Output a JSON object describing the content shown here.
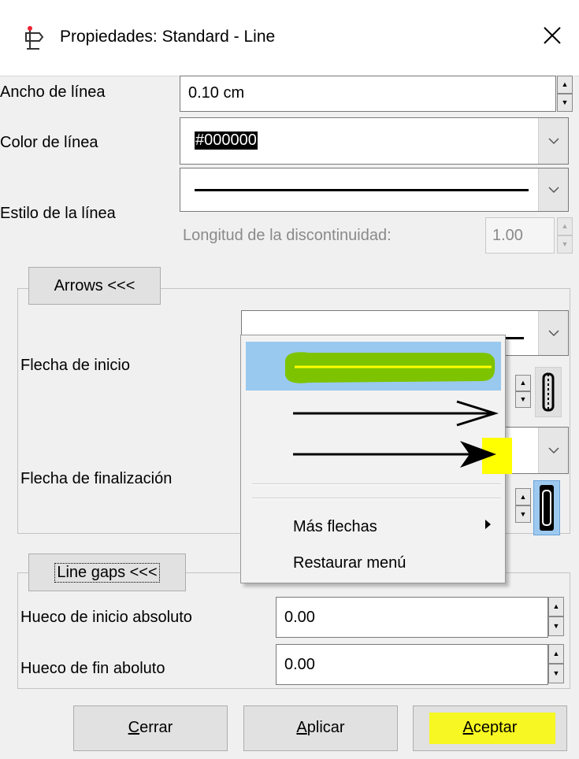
{
  "window": {
    "title": "Propiedades: Standard - Line",
    "close_icon": "close-icon",
    "app_icon": "properties-icon"
  },
  "line": {
    "width_label": "Ancho de línea",
    "width_value": "0.10 cm",
    "color_label": "Color de línea",
    "color_value": "#000000",
    "style_label": "Estilo de la línea",
    "dash_label": "Longitud de la discontinuidad:",
    "dash_value": "1.00"
  },
  "arrows": {
    "toggle_label": "Arrows <<<",
    "start_label": "Flecha de inicio",
    "end_label": "Flecha de finalización"
  },
  "menu": {
    "items": [
      "line-no-arrow",
      "line-open-arrow",
      "line-filled-arrow"
    ],
    "more_label": "Más flechas",
    "restore_label": "Restaurar menú",
    "highlight_color": "#99c9ef",
    "marker_green": "#7ec300",
    "marker_yellow": "#ffff00"
  },
  "gaps": {
    "toggle_label": "Line gaps <<<",
    "start_label": "Hueco de inicio absoluto",
    "start_value": "0.00",
    "end_label": "Hueco de fin aboluto",
    "end_value": "0.00"
  },
  "buttons": {
    "close": "Cerrar",
    "apply": "Aplicar",
    "ok": "Aceptar"
  }
}
